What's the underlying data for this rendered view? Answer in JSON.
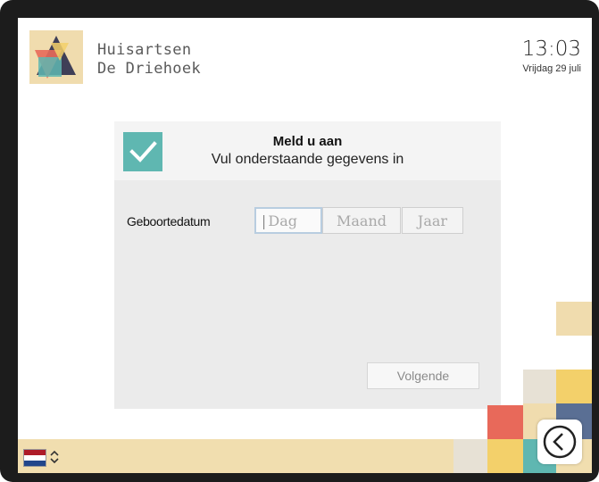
{
  "header": {
    "brand_line1": "Huisartsen",
    "brand_line2": "De Driehoek",
    "time": "13:03",
    "date": "Vrijdag 29 juli"
  },
  "card": {
    "title": "Meld u aan",
    "subtitle": "Vul onderstaande gegevens in",
    "dob_label": "Geboortedatum",
    "fields": {
      "day_placeholder": "Dag",
      "month_placeholder": "Maand",
      "year_placeholder": "Jaar"
    },
    "next_label": "Volgende"
  },
  "footer": {
    "language_flag": "netherlands-flag",
    "language_colors": [
      "#ae1c28",
      "#ffffff",
      "#21468b"
    ]
  },
  "colors": {
    "accent_teal": "#5fb7b1",
    "sand": "#f1deaf",
    "coral": "#e8695a",
    "navy": "#5a6f94",
    "yellow": "#f3d06a"
  },
  "icons": {
    "logo": "triangle-logo",
    "check": "checkmark-icon",
    "back": "back-arrow-icon",
    "chevron": "updown-chevron-icon"
  }
}
